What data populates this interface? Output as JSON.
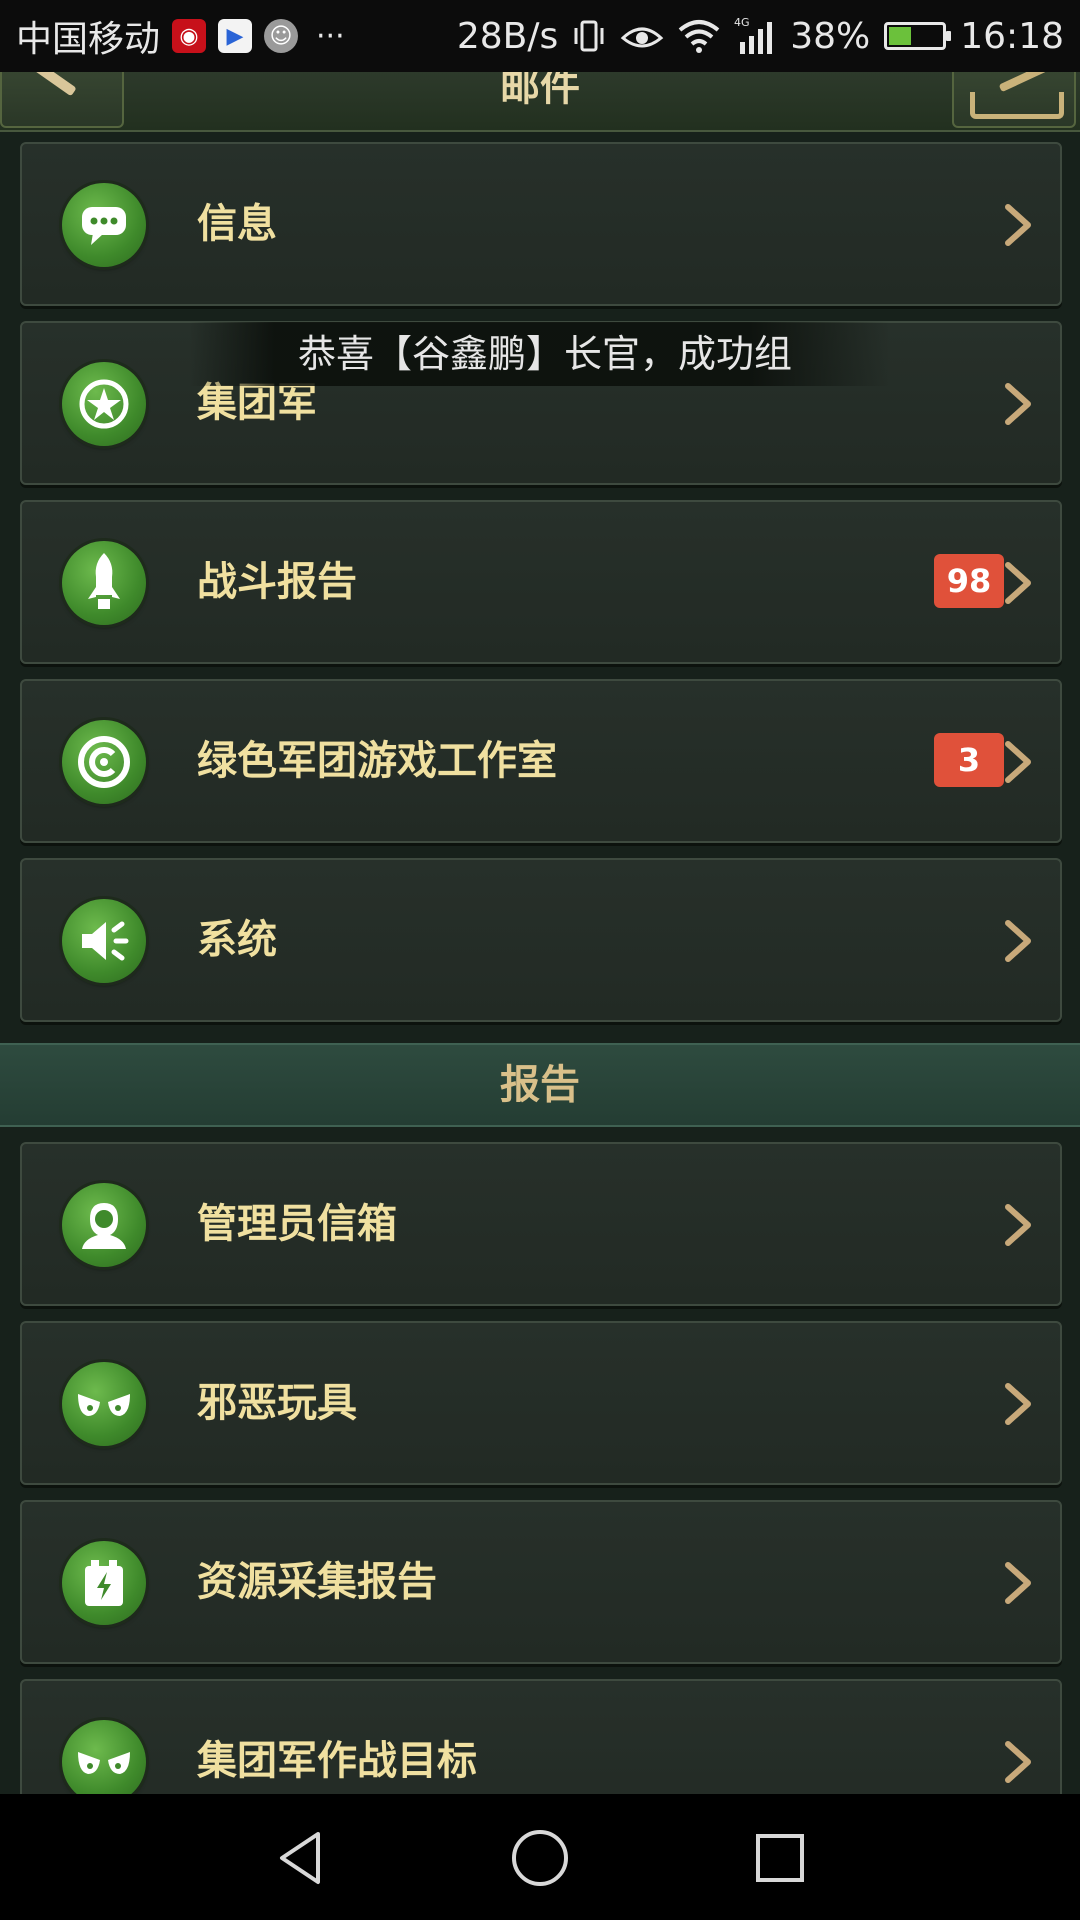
{
  "statusbar": {
    "carrier": "中国移动",
    "apps": [
      "netease-music-icon",
      "video-app-icon",
      "avatar-icon"
    ],
    "more": "···",
    "speed": "28B/s",
    "network": "4G",
    "battery": "38%",
    "battery_level": 0.38,
    "time": "16:18"
  },
  "header": {
    "title": "邮件"
  },
  "messages": {
    "items": [
      {
        "label": "信息",
        "icon": "chat-bubble-icon",
        "badge": ""
      },
      {
        "label": "集团军",
        "icon": "star-icon",
        "badge": ""
      },
      {
        "label": "战斗报告",
        "icon": "missile-icon",
        "badge": "98"
      },
      {
        "label": "绿色军团游戏工作室",
        "icon": "copyright-icon",
        "badge": "3"
      },
      {
        "label": "系统",
        "icon": "speaker-icon",
        "badge": ""
      }
    ]
  },
  "section": {
    "title": "报告"
  },
  "reports": {
    "items": [
      {
        "label": "管理员信箱",
        "icon": "person-icon",
        "badge": ""
      },
      {
        "label": "邪恶玩具",
        "icon": "evil-eyes-icon",
        "badge": ""
      },
      {
        "label": "资源采集报告",
        "icon": "battery-icon",
        "badge": ""
      },
      {
        "label": "集团军作战目标",
        "icon": "evil-eyes-icon",
        "badge": ""
      }
    ]
  },
  "toast": {
    "text": "恭喜【谷鑫鹏】长官，成功组"
  },
  "colors": {
    "label": "#f0e0a0",
    "badge": "#e0513a",
    "icon": "#4e9a34",
    "section_header": "#2e4b3f"
  }
}
